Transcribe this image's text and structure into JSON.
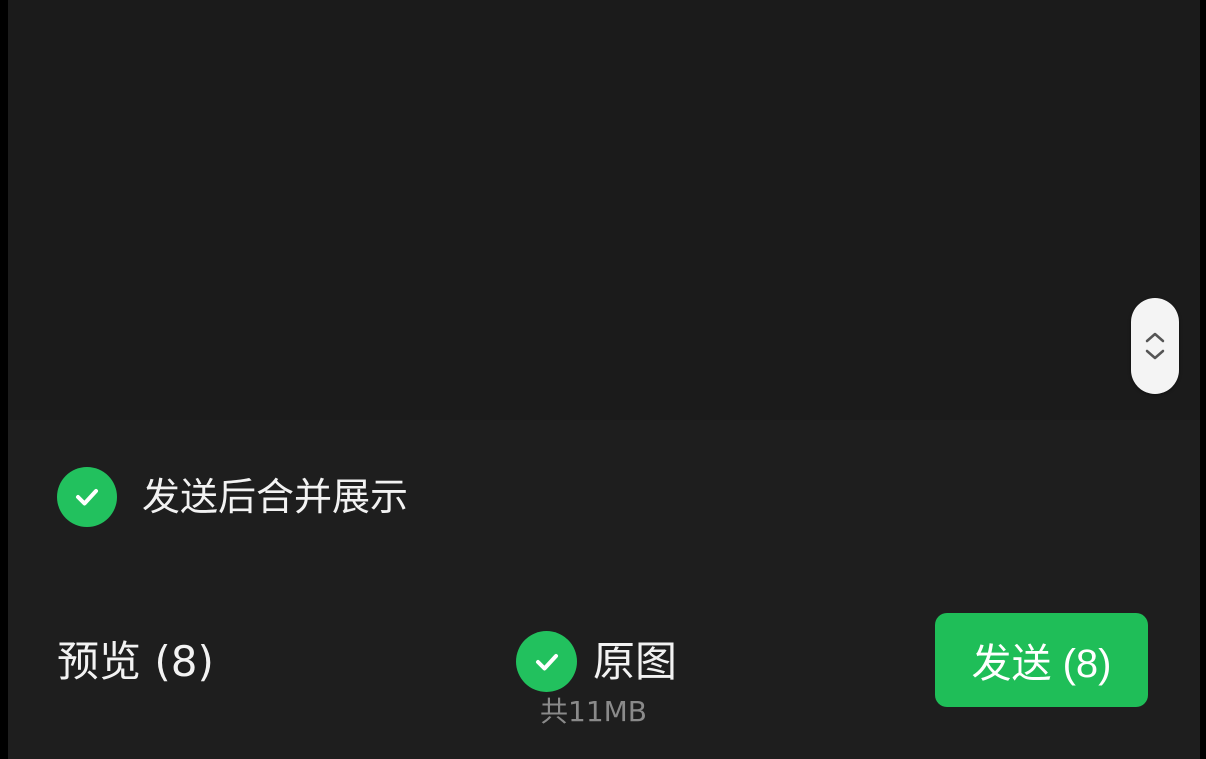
{
  "scroll_handle": {
    "up_icon": "chevron-up-icon",
    "down_icon": "chevron-down-icon"
  },
  "merge_option": {
    "checked": true,
    "label": "发送后合并展示"
  },
  "toolbar": {
    "preview_label": "预览 (8)",
    "original_checked": true,
    "original_label": "原图",
    "size_label": "共11MB",
    "send_label": "发送 (8)"
  },
  "colors": {
    "accent": "#1fbe58",
    "background": "#1b1b1b",
    "text": "#f2f2f2",
    "muted_text": "#8a8a8a"
  }
}
